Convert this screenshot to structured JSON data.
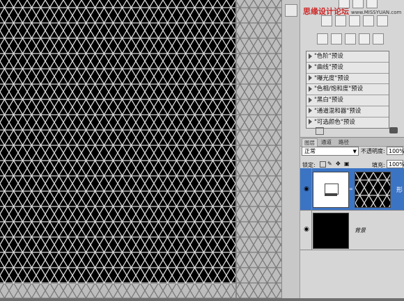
{
  "watermark": {
    "text": "思缘设计论坛",
    "url": "www.MISSYUAN.com"
  },
  "adjustments_presets": [
    "\"色阶\"预设",
    "\"曲线\"预设",
    "\"曝光度\"预设",
    "\"色相/饱和度\"预设",
    "\"黑白\"预设",
    "\"通道混和器\"预设",
    "\"可选颜色\"预设"
  ],
  "layers_panel": {
    "tabs": [
      "图层",
      "通道",
      "路径"
    ],
    "blend_mode": "正常",
    "opacity_label": "不透明度:",
    "opacity_value": "100%",
    "lock_label": "锁定:",
    "fill_label": "填充:",
    "fill_value": "100%",
    "layers": [
      {
        "name": "形",
        "selected": true,
        "visible": true
      },
      {
        "name": "背景",
        "selected": false,
        "visible": true
      }
    ]
  },
  "colors": {
    "selection": "#3c74c4",
    "canvas": "#000000",
    "grid_line": "#d0d0d0"
  }
}
